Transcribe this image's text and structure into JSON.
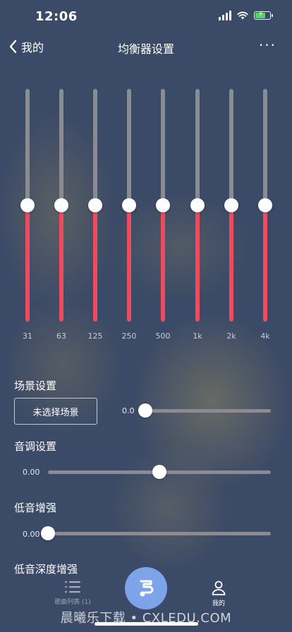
{
  "status_bar": {
    "time": "12:06"
  },
  "nav": {
    "back_label": "我的",
    "title": "均衡器设置",
    "more": "···"
  },
  "equalizer": {
    "bands": [
      {
        "label": "31",
        "gain": 0
      },
      {
        "label": "63",
        "gain": 0
      },
      {
        "label": "125",
        "gain": 0
      },
      {
        "label": "250",
        "gain": 0
      },
      {
        "label": "500",
        "gain": 0
      },
      {
        "label": "1k",
        "gain": 0
      },
      {
        "label": "2k",
        "gain": 0
      },
      {
        "label": "4k",
        "gain": 0
      }
    ],
    "level_fraction": 0.5,
    "colors": {
      "active": "#ef4a5e",
      "inactive": "#8b8b93",
      "knob": "#ffffff"
    }
  },
  "scene": {
    "title": "场景设置",
    "button_label": "未选择场景",
    "value": "0.0",
    "fraction": 0.0
  },
  "pitch": {
    "title": "音调设置",
    "value": "0.00",
    "fraction": 0.5
  },
  "bass": {
    "title": "低音增强",
    "value": "0.00",
    "fraction": 0.0
  },
  "deep_bass": {
    "title": "低音深度增强"
  },
  "tabbar": {
    "song_list_label": "歌曲列表 (1)",
    "mine_label": "我的",
    "accent": "#7da4e9"
  },
  "watermark": "晨曦乐下载 • CXLEDU.COM",
  "background": "#3b4a66"
}
